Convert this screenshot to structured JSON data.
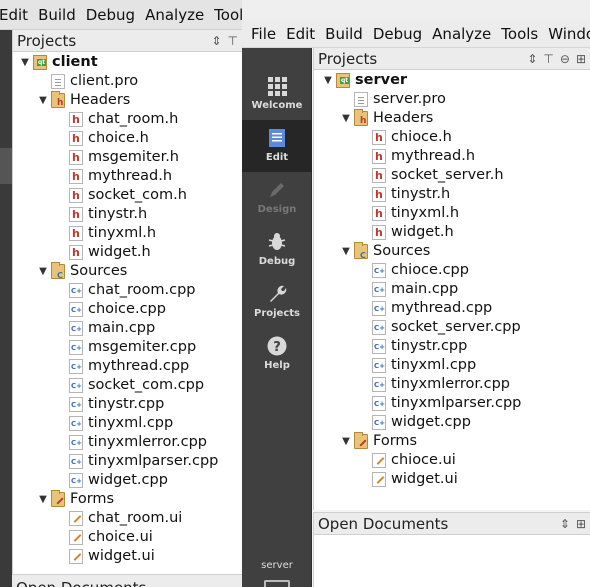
{
  "back_window": {
    "menu": [
      "Edit",
      "Build",
      "Debug",
      "Analyze",
      "Tools"
    ],
    "panel_title": "Projects",
    "open_documents_title": "Open Documents",
    "tree": [
      {
        "label": "client",
        "kind": "project",
        "depth": 0,
        "bold": true,
        "expanded": true
      },
      {
        "label": "client.pro",
        "kind": "pro",
        "depth": 1
      },
      {
        "label": "Headers",
        "kind": "folder-headers",
        "depth": 1,
        "expanded": true
      },
      {
        "label": "chat_room.h",
        "kind": "h",
        "depth": 2
      },
      {
        "label": "choice.h",
        "kind": "h",
        "depth": 2
      },
      {
        "label": "msgemiter.h",
        "kind": "h",
        "depth": 2
      },
      {
        "label": "mythread.h",
        "kind": "h",
        "depth": 2
      },
      {
        "label": "socket_com.h",
        "kind": "h",
        "depth": 2
      },
      {
        "label": "tinystr.h",
        "kind": "h",
        "depth": 2
      },
      {
        "label": "tinyxml.h",
        "kind": "h",
        "depth": 2
      },
      {
        "label": "widget.h",
        "kind": "h",
        "depth": 2
      },
      {
        "label": "Sources",
        "kind": "folder-sources",
        "depth": 1,
        "expanded": true
      },
      {
        "label": "chat_room.cpp",
        "kind": "cpp",
        "depth": 2
      },
      {
        "label": "choice.cpp",
        "kind": "cpp",
        "depth": 2
      },
      {
        "label": "main.cpp",
        "kind": "cpp",
        "depth": 2
      },
      {
        "label": "msgemiter.cpp",
        "kind": "cpp",
        "depth": 2
      },
      {
        "label": "mythread.cpp",
        "kind": "cpp",
        "depth": 2
      },
      {
        "label": "socket_com.cpp",
        "kind": "cpp",
        "depth": 2
      },
      {
        "label": "tinystr.cpp",
        "kind": "cpp",
        "depth": 2
      },
      {
        "label": "tinyxml.cpp",
        "kind": "cpp",
        "depth": 2
      },
      {
        "label": "tinyxmlerror.cpp",
        "kind": "cpp",
        "depth": 2
      },
      {
        "label": "tinyxmlparser.cpp",
        "kind": "cpp",
        "depth": 2
      },
      {
        "label": "widget.cpp",
        "kind": "cpp",
        "depth": 2
      },
      {
        "label": "Forms",
        "kind": "folder-forms",
        "depth": 1,
        "expanded": true
      },
      {
        "label": "chat_room.ui",
        "kind": "ui",
        "depth": 2
      },
      {
        "label": "choice.ui",
        "kind": "ui",
        "depth": 2
      },
      {
        "label": "widget.ui",
        "kind": "ui",
        "depth": 2
      }
    ]
  },
  "front_window": {
    "menu": [
      "File",
      "Edit",
      "Build",
      "Debug",
      "Analyze",
      "Tools",
      "Window"
    ],
    "panel_title": "Projects",
    "open_documents_title": "Open Documents",
    "modes": [
      {
        "label": "Welcome",
        "icon": "grid-icon",
        "active": false,
        "disabled": false
      },
      {
        "label": "Edit",
        "icon": "document-icon",
        "active": true,
        "disabled": false
      },
      {
        "label": "Design",
        "icon": "pencil-icon",
        "active": false,
        "disabled": true
      },
      {
        "label": "Debug",
        "icon": "bug-icon",
        "active": false,
        "disabled": false
      },
      {
        "label": "Projects",
        "icon": "wrench-icon",
        "active": false,
        "disabled": false
      },
      {
        "label": "Help",
        "icon": "help-icon",
        "active": false,
        "disabled": false
      }
    ],
    "target_label": "server",
    "tree": [
      {
        "label": "server",
        "kind": "project",
        "depth": 0,
        "bold": true,
        "expanded": true
      },
      {
        "label": "server.pro",
        "kind": "pro",
        "depth": 1
      },
      {
        "label": "Headers",
        "kind": "folder-headers",
        "depth": 1,
        "expanded": true
      },
      {
        "label": "chioce.h",
        "kind": "h",
        "depth": 2
      },
      {
        "label": "mythread.h",
        "kind": "h",
        "depth": 2
      },
      {
        "label": "socket_server.h",
        "kind": "h",
        "depth": 2
      },
      {
        "label": "tinystr.h",
        "kind": "h",
        "depth": 2
      },
      {
        "label": "tinyxml.h",
        "kind": "h",
        "depth": 2
      },
      {
        "label": "widget.h",
        "kind": "h",
        "depth": 2
      },
      {
        "label": "Sources",
        "kind": "folder-sources",
        "depth": 1,
        "expanded": true
      },
      {
        "label": "chioce.cpp",
        "kind": "cpp",
        "depth": 2
      },
      {
        "label": "main.cpp",
        "kind": "cpp",
        "depth": 2
      },
      {
        "label": "mythread.cpp",
        "kind": "cpp",
        "depth": 2
      },
      {
        "label": "socket_server.cpp",
        "kind": "cpp",
        "depth": 2
      },
      {
        "label": "tinystr.cpp",
        "kind": "cpp",
        "depth": 2
      },
      {
        "label": "tinyxml.cpp",
        "kind": "cpp",
        "depth": 2
      },
      {
        "label": "tinyxmlerror.cpp",
        "kind": "cpp",
        "depth": 2
      },
      {
        "label": "tinyxmlparser.cpp",
        "kind": "cpp",
        "depth": 2
      },
      {
        "label": "widget.cpp",
        "kind": "cpp",
        "depth": 2
      },
      {
        "label": "Forms",
        "kind": "folder-forms",
        "depth": 1,
        "expanded": true
      },
      {
        "label": "chioce.ui",
        "kind": "ui",
        "depth": 2
      },
      {
        "label": "widget.ui",
        "kind": "ui",
        "depth": 2
      }
    ]
  }
}
